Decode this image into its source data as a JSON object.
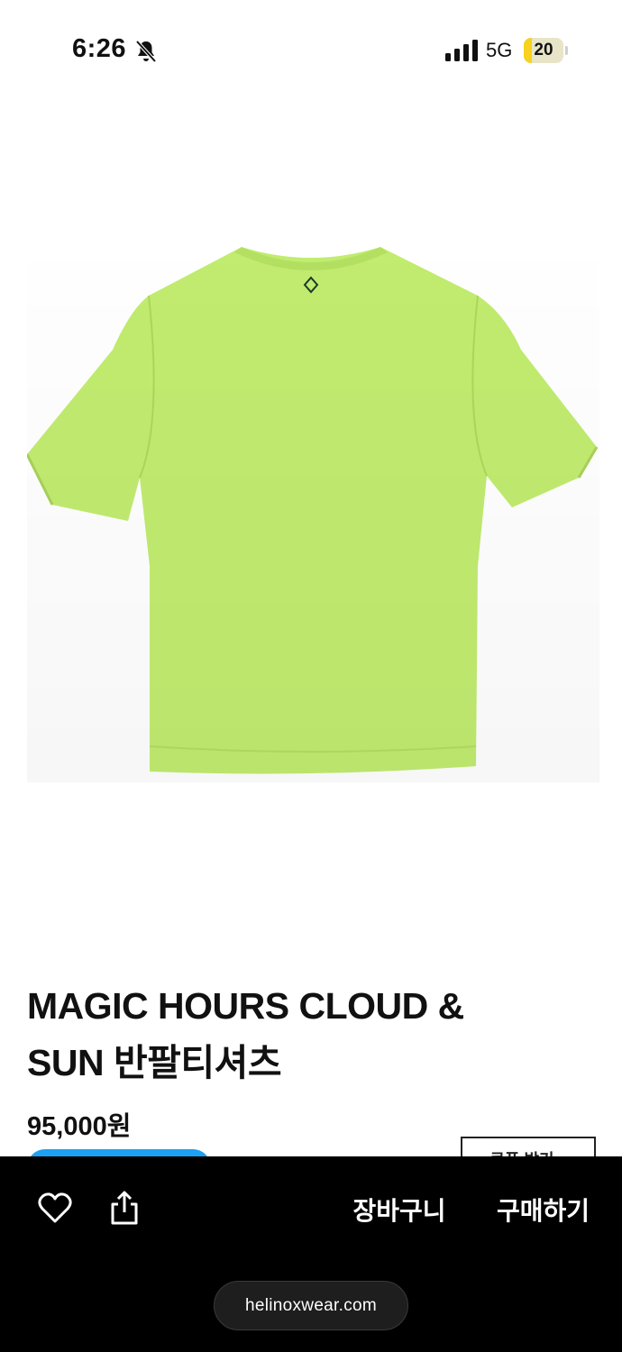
{
  "status_bar": {
    "time": "6:26",
    "network": "5G",
    "battery_level": "20",
    "battery_fraction": 0.2
  },
  "product": {
    "image_icon": "tshirt-back-image",
    "shirt_color": "#c1ec6f",
    "title_line1": "MAGIC HOURS CLOUD &",
    "title_line2": "SUN 반팔티셔츠",
    "price": "95,000원",
    "coupon_label": "쿠폰 받기 ↓"
  },
  "bottom_bar": {
    "wishlist_icon": "heart-icon",
    "share_icon": "share-icon",
    "cart_label": "장바구니",
    "buy_label": "구매하기"
  },
  "browser": {
    "url": "helinoxwear.com"
  },
  "colors": {
    "accent_blue": "#1da1f2",
    "battery_yellow": "#f7d21e"
  }
}
